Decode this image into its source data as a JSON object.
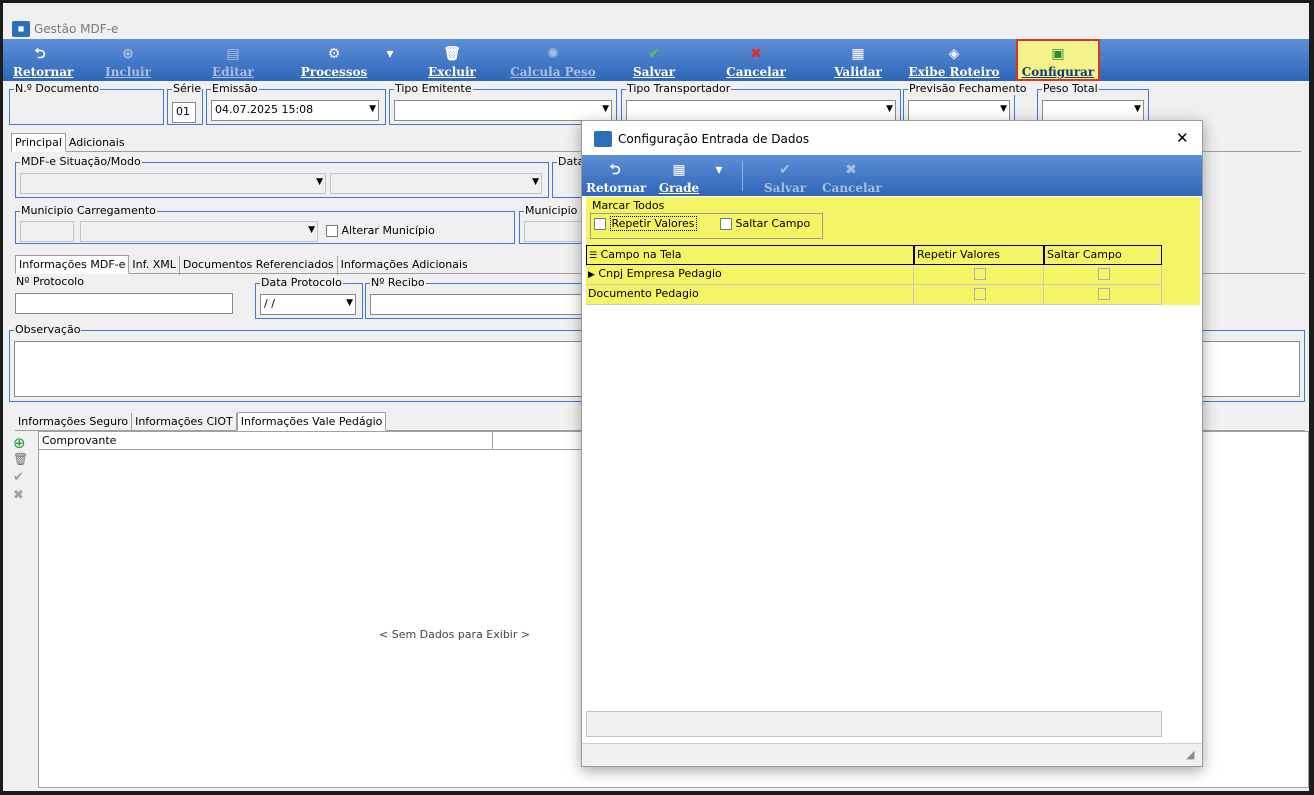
{
  "window": {
    "title": "Gestão MDF-e"
  },
  "toolbar": {
    "buttons": [
      {
        "label": "Retornar",
        "icon": "return-arrow-icon"
      },
      {
        "label": "Incluir",
        "icon": "plus-circle-icon"
      },
      {
        "label": "Editar",
        "icon": "edit-icon"
      },
      {
        "label": "Processos",
        "icon": "gear-icon"
      },
      {
        "label": "Excluir",
        "icon": "trash-icon"
      },
      {
        "label": "Calcula Peso",
        "icon": "scale-icon"
      },
      {
        "label": "Salvar",
        "icon": "check-icon"
      },
      {
        "label": "Cancelar",
        "icon": "x-icon"
      },
      {
        "label": "Validar",
        "icon": "validate-icon"
      },
      {
        "label": "Exibe Roteiro",
        "icon": "route-icon"
      },
      {
        "label": "Configurar",
        "icon": "config-icon"
      }
    ],
    "dropdown_glyph": "▾"
  },
  "header_fields": {
    "documento_label": "N.º Documento",
    "serie_label": "Série",
    "serie_value": "01",
    "emissao_label": "Emissão",
    "emissao_value": "04.07.2025 15:08",
    "tipo_emitente_label": "Tipo Emitente",
    "tipo_transportador_label": "Tipo Transportador",
    "previsao_label": "Previsão Fechamento",
    "peso_label": "Peso Total"
  },
  "main_tabs": [
    "Principal",
    "Adicionais"
  ],
  "principal": {
    "situacao_label": "MDF-e Situação/Modo",
    "data_label": "Data",
    "municipio_carregamento_label": "Municipio Carregamento",
    "alterar_municipio_label": "Alterar Município",
    "municipio_d_label": "Municipio D"
  },
  "info_tabs": [
    "Informações MDF-e",
    "Inf. XML",
    "Documentos Referenciados",
    "Informações Adicionais"
  ],
  "info": {
    "protocolo_label": "Nº Protocolo",
    "data_protocolo_label": "Data Protocolo",
    "data_protocolo_value": "/ /",
    "recibo_label": "Nº Recibo",
    "observacao_label": "Observação"
  },
  "lower_tabs": [
    "Informações Seguro",
    "Informações CIOT",
    "Informações Vale Pedágio"
  ],
  "vale_pedagio": {
    "column": "Comprovante",
    "empty_text": "< Sem Dados para Exibir >"
  },
  "dialog": {
    "title": "Configuração Entrada de Dados",
    "close_glyph": "✕",
    "toolbar": [
      {
        "label": "Retornar",
        "icon": "return-arrow-icon"
      },
      {
        "label": "Grade",
        "icon": "grid-icon"
      },
      {
        "label": "Salvar",
        "icon": "check-icon"
      },
      {
        "label": "Cancelar",
        "icon": "x-icon"
      }
    ],
    "marcar_todos_label": "Marcar Todos",
    "repetir_valores_label": "Repetir Valores",
    "saltar_campo_label": "Saltar Campo",
    "grid": {
      "columns": [
        "Campo na Tela",
        "Repetir Valores",
        "Saltar Campo"
      ],
      "rows": [
        {
          "campo": "Cnpj Empresa Pedagio",
          "repetir": false,
          "saltar": false
        },
        {
          "campo": "Documento Pedagio",
          "repetir": false,
          "saltar": false
        }
      ]
    }
  },
  "colors": {
    "toolbar_blue": "#2f66b8",
    "group_border": "#3d79d6",
    "highlight_yellow": "#f5f465",
    "highlight_red": "#d8342b"
  }
}
